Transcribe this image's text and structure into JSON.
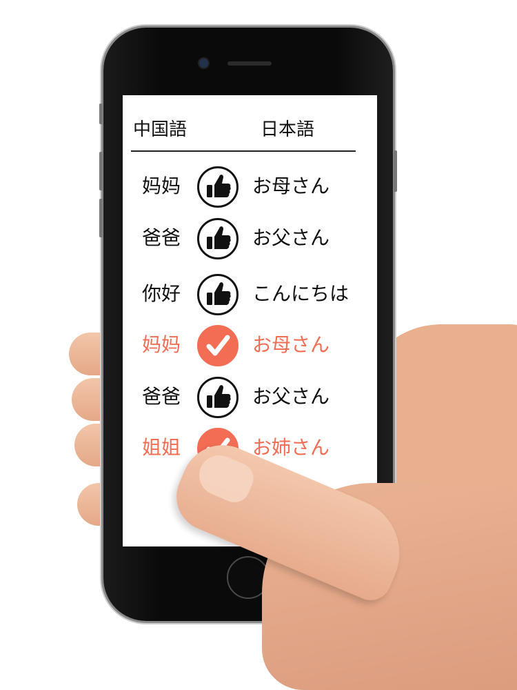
{
  "header": {
    "col_chinese": "中国語",
    "col_japanese": "日本語"
  },
  "rows": [
    {
      "chinese": "妈妈",
      "japanese": "お母さん",
      "status": "thumbs-up"
    },
    {
      "chinese": "爸爸",
      "japanese": "お父さん",
      "status": "thumbs-up"
    },
    {
      "chinese": "你好",
      "japanese": "こんにちは",
      "status": "thumbs-up"
    },
    {
      "chinese": "妈妈",
      "japanese": "お母さん",
      "status": "checked"
    },
    {
      "chinese": "爸爸",
      "japanese": "お父さん",
      "status": "thumbs-up"
    },
    {
      "chinese": "姐姐",
      "japanese": "お姉さん",
      "status": "checked"
    }
  ],
  "colors": {
    "accent": "#f36d55",
    "text": "#111111",
    "screen": "#ffffff"
  }
}
